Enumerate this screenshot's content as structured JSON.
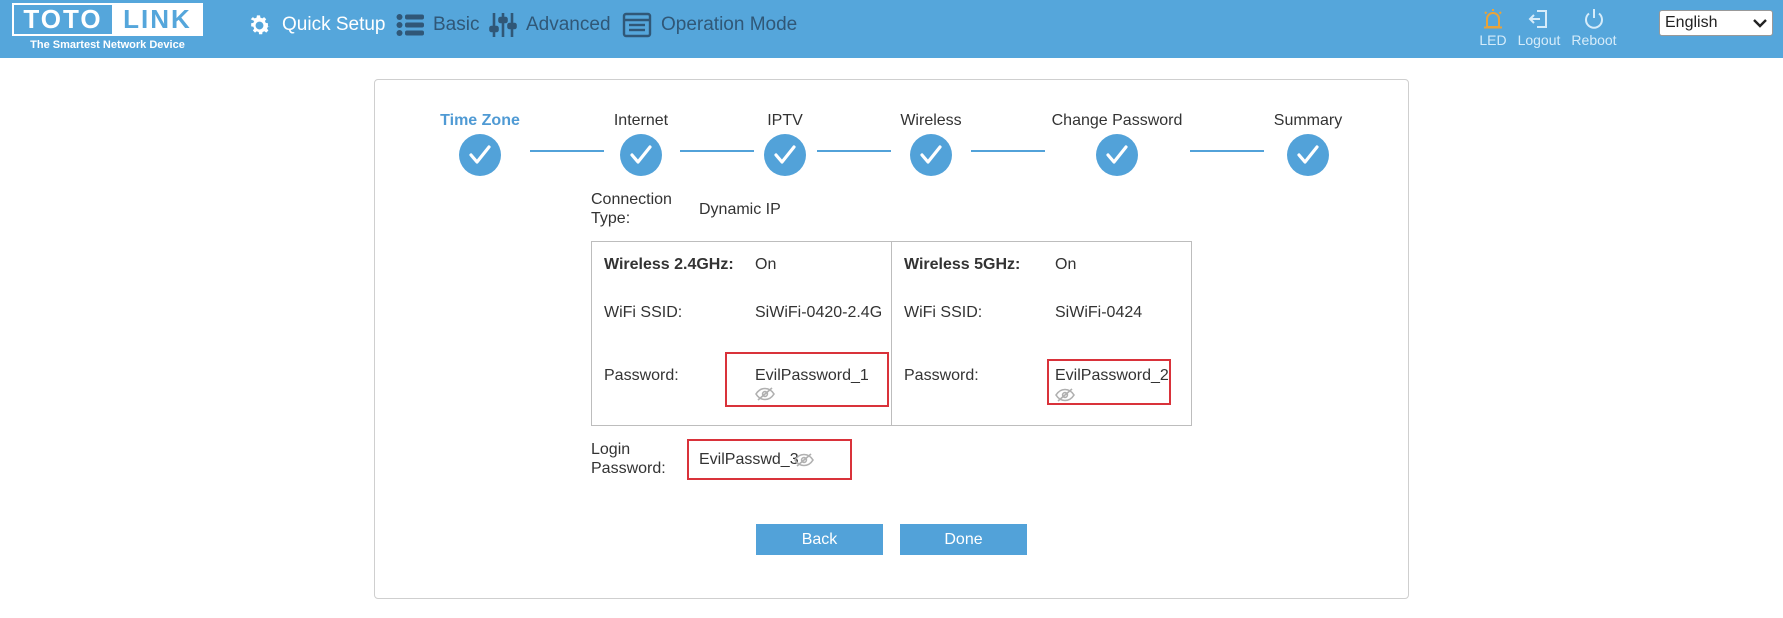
{
  "brand": {
    "logo_left": "TOTO",
    "logo_right": "LINK",
    "tagline": "The Smartest Network Device"
  },
  "nav": {
    "quick_setup": "Quick Setup",
    "basic": "Basic",
    "advanced": "Advanced",
    "operation_mode": "Operation Mode"
  },
  "tools": {
    "led": "LED",
    "logout": "Logout",
    "reboot": "Reboot"
  },
  "language": {
    "selected": "English"
  },
  "steps": [
    {
      "label": "Time Zone",
      "state": "active-complete"
    },
    {
      "label": "Internet",
      "state": "complete"
    },
    {
      "label": "IPTV",
      "state": "complete"
    },
    {
      "label": "Wireless",
      "state": "complete"
    },
    {
      "label": "Change Password",
      "state": "complete"
    },
    {
      "label": "Summary",
      "state": "complete"
    }
  ],
  "summary": {
    "connection_type_label_1": "Connection",
    "connection_type_label_2": "Type:",
    "connection_type_value": "Dynamic IP",
    "w24": {
      "title": "Wireless 2.4GHz:",
      "status": "On",
      "ssid_label": "WiFi SSID:",
      "ssid": "SiWiFi-0420-2.4G",
      "password_label": "Password:",
      "password": "EvilPassword_1"
    },
    "w5": {
      "title": "Wireless 5GHz:",
      "status": "On",
      "ssid_label": "WiFi SSID:",
      "ssid": "SiWiFi-0424",
      "password_label": "Password:",
      "password": "EvilPassword_2"
    },
    "login_label_1": "Login",
    "login_label_2": "Password:",
    "login_password": "EvilPasswd_3"
  },
  "buttons": {
    "back": "Back",
    "done": "Done"
  },
  "colors": {
    "header_bg": "#55a6db",
    "accent": "#52a2d9",
    "highlight_border": "#d9323a",
    "led_icon": "#e8a33a"
  }
}
